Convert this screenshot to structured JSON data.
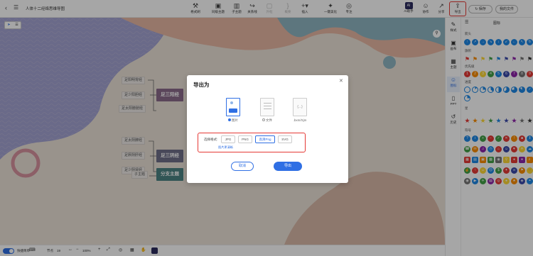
{
  "topbar": {
    "title": "人体十二经络思维导图",
    "tools": [
      {
        "label": "格式刷",
        "icon": "format-brush-icon"
      },
      {
        "label": "同级主题",
        "icon": "sibling-topic-icon"
      },
      {
        "label": "子主题",
        "icon": "child-topic-icon"
      },
      {
        "label": "关系线",
        "icon": "relation-line-icon"
      },
      {
        "label": "外框",
        "icon": "frame-icon"
      },
      {
        "label": "概要",
        "icon": "summary-icon"
      },
      {
        "label": "插入",
        "icon": "insert-icon"
      },
      {
        "label": "一键美化",
        "icon": "beautify-icon"
      },
      {
        "label": "专注",
        "icon": "focus-icon"
      }
    ],
    "ai_label": "AI助手",
    "collab_label": "协作",
    "share_label": "分享",
    "export_label": "导出",
    "save_label": "保存",
    "my_files_label": "我的文件"
  },
  "rail": {
    "items": [
      {
        "label": "样式"
      },
      {
        "label": "画布"
      },
      {
        "label": "主题"
      },
      {
        "label": "图标"
      },
      {
        "label": "PPT"
      },
      {
        "label": "历史"
      }
    ]
  },
  "panel": {
    "tab_label": "图标",
    "sections": [
      "箭头",
      "旗帜",
      "优先级",
      "进度",
      "星",
      "符号"
    ],
    "colors": [
      "#e53935",
      "#fb8c00",
      "#fdd835",
      "#43a047",
      "#1e88e5",
      "#3949ab",
      "#8e24aa",
      "#757575"
    ],
    "priority_numbers": [
      "1",
      "2",
      "3",
      "4",
      "5",
      "6",
      "7",
      "8"
    ]
  },
  "mindmap": {
    "branches": [
      {
        "label": "足三阳经",
        "color": "#8a6a8a",
        "leaves": [
          "足阳明胃经",
          "足少阳胆经",
          "足太阳膀胱经"
        ]
      },
      {
        "label": "足三阴经",
        "color": "#6f6f89",
        "leaves": [
          "足太阴脾经",
          "足厥阴肝经",
          "足少阴肾经"
        ]
      },
      {
        "label": "分支主题",
        "color": "#4c8383",
        "leaves": [
          "子主题"
        ]
      }
    ]
  },
  "bottombar": {
    "quick_shortcut_label": "快捷简单",
    "node_label": "节点",
    "node_count": "19",
    "zoom": "100%"
  },
  "modal": {
    "title": "导出为",
    "types": [
      {
        "label": "图片",
        "icon": "image-file-icon"
      },
      {
        "label": "文件",
        "icon": "document-file-icon"
      },
      {
        "label": ".bxm/Xjm",
        "icon": "code-file-icon"
      }
    ],
    "format_label": "选择格式:",
    "formats": [
      "JPG",
      "PNG",
      "高清Png",
      "SVG"
    ],
    "selected_format": "高清Png",
    "link_text": "图片更清晰",
    "cancel_label": "取消",
    "export_label": "导出"
  }
}
